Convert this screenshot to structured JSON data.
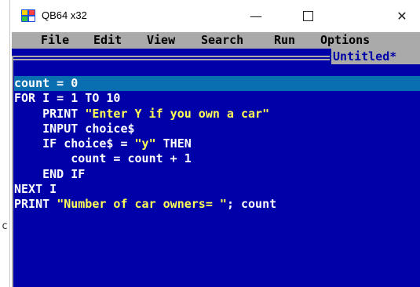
{
  "window": {
    "title": "QB64 x32",
    "min": "—",
    "close": "✕"
  },
  "menu": {
    "file": "File",
    "edit": "Edit",
    "view": "View",
    "search": "Search",
    "run": "Run",
    "options": "Options"
  },
  "editor": {
    "tab": "Untitled*",
    "lines": [
      {
        "a": "count = 0"
      },
      {
        "a": "FOR I = 1 TO 10"
      },
      {
        "a": "    PRINT ",
        "s": "\"Enter Y if you own a car\""
      },
      {
        "a": "    INPUT choice$"
      },
      {
        "a": "    IF choice$ = ",
        "s": "\"y\"",
        "b": " THEN"
      },
      {
        "a": "        count = count + 1"
      },
      {
        "a": "    END IF"
      },
      {
        "a": "NEXT I"
      },
      {
        "a": "PRINT ",
        "s": "\"Number of car owners= \"",
        "b": "; count"
      }
    ]
  },
  "left_mark": "c",
  "colors": {
    "qb_blue": "#0000a8",
    "menu_gray": "#aaaaaa",
    "string": "#ffff55",
    "cursor_line": "#0a6fb0"
  }
}
